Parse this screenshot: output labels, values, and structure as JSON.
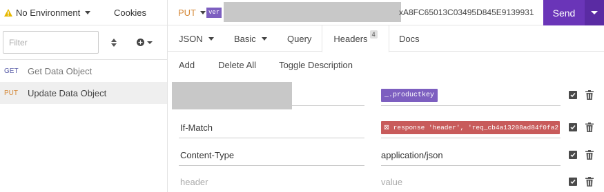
{
  "sidebar": {
    "environment": "No Environment",
    "cookies": "Cookies",
    "filter_placeholder": "Filter",
    "requests": [
      {
        "method": "GET",
        "name": "Get Data Object"
      },
      {
        "method": "PUT",
        "name": "Update Data Object"
      }
    ]
  },
  "url_bar": {
    "method": "PUT",
    "var_tag": "ver",
    "url_tail": "xA8FC65013C03495D845E9139931",
    "send_label": "Send"
  },
  "tabs": {
    "body": "JSON",
    "auth": "Basic",
    "query": "Query",
    "headers": "Headers",
    "headers_count": "4",
    "docs": "Docs"
  },
  "actions": {
    "add": "Add",
    "delete_all": "Delete All",
    "toggle_description": "Toggle Description"
  },
  "headers": [
    {
      "name": "",
      "value_tag": "_.productkey"
    },
    {
      "name": "If-Match",
      "value_tag": "⊠ response 'header', 'req_cb4a13208ad84f0fa2"
    },
    {
      "name": "Content-Type",
      "value": "application/json"
    },
    {
      "name_placeholder": "header",
      "value_placeholder": "value"
    }
  ],
  "colors": {
    "accent": "#6a35b8",
    "put_method": "#d58a3b",
    "get_method": "#5a5ea8",
    "env_tag": "#7d5fc0",
    "response_tag": "#c85b5b"
  }
}
